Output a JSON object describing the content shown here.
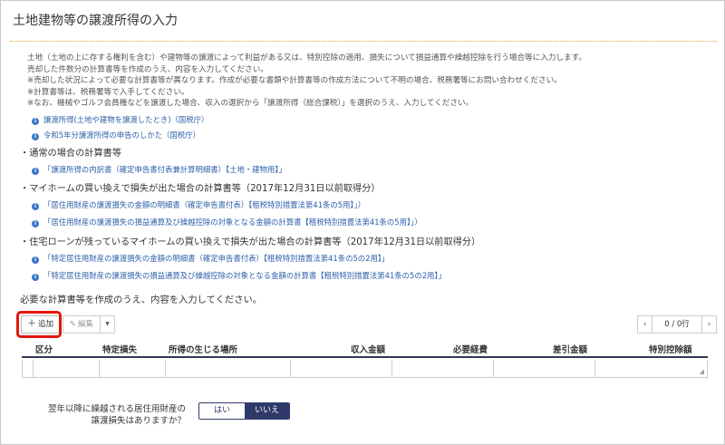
{
  "page": {
    "title": "土地建物等の譲渡所得の入力"
  },
  "description": [
    "土地（土地の上に存する権利を含む）や建物等の譲渡によって利益がある又は、特別控除の適用、損失について損益通算や繰越控除を行う場合等に入力します。",
    "売却した件数分の計算書等を作成のうえ、内容を入力してください。",
    "※売却した状況によって必要な計算書等が異なります。作成が必要な書類や計算書等の作成方法について不明の場合、税務署等にお問い合わせください。",
    "※計算書等は、税務署等で入手してください。",
    "※なお、機械やゴルフ会員権などを譲渡した場合、収入の選択から「譲渡所得（総合課税）」を選択のうえ、入力してください。"
  ],
  "info_links": [
    "譲渡所得(土地や建物を譲渡したとき)（国税庁）",
    "令和5年分譲渡所得の申告のしかた（国税庁）"
  ],
  "sections": [
    {
      "heading": "通常の場合の計算書等",
      "links": [
        "「譲渡所得の内訳書（確定申告書付表兼計算明細書）【土地・建物用】」"
      ]
    },
    {
      "heading": "マイホームの買い換えで損失が出た場合の計算書等（2017年12月31日以前取得分）",
      "links": [
        "「居住用財産の譲渡損失の金額の明細書（確定申告書付表）【租税特別措置法第41条の5用】」）",
        "「居住用財産の譲渡損失の損益通算及び繰越控除の対象となる金額の計算書【租税特別措置法第41条の5用】」）"
      ]
    },
    {
      "heading": "住宅ローンが残っているマイホームの買い換えで損失が出た場合の計算書等（2017年12月31日以前取得分）",
      "links": [
        "「特定居住用財産の譲渡損失の金額の明細書（確定申告書付表）【租税特別措置法第41条の5の2用】」",
        "「特定居住用財産の譲渡損失の損益通算及び繰越控除の対象となる金額の計算書【租税特別措置法第41条の5の2用】」"
      ]
    }
  ],
  "instruction": "必要な計算書等を作成のうえ、内容を入力してください。",
  "toolbar": {
    "add_label": "追加",
    "add_icon": "plus-icon",
    "edit_label": "編集",
    "edit_icon": "pencil-icon",
    "dropdown_icon": "caret-down-icon"
  },
  "pager": {
    "prev": "‹",
    "next": "›",
    "text": "0 / 0行"
  },
  "grid": {
    "columns": [
      "区分",
      "特定損失",
      "所得の生じる場所",
      "収入金額",
      "必要経費",
      "差引金額",
      "特別控除額"
    ],
    "rows": []
  },
  "question": {
    "label": "翌年以降に繰越される居住用財産の譲渡損失はありますか？",
    "options": [
      "はい",
      "いいえ"
    ],
    "selected": "いいえ"
  },
  "colors": {
    "accent": "#e6a23c",
    "link": "#2c5fa8",
    "navy": "#2f3a6b",
    "highlight": "#e3170a"
  }
}
